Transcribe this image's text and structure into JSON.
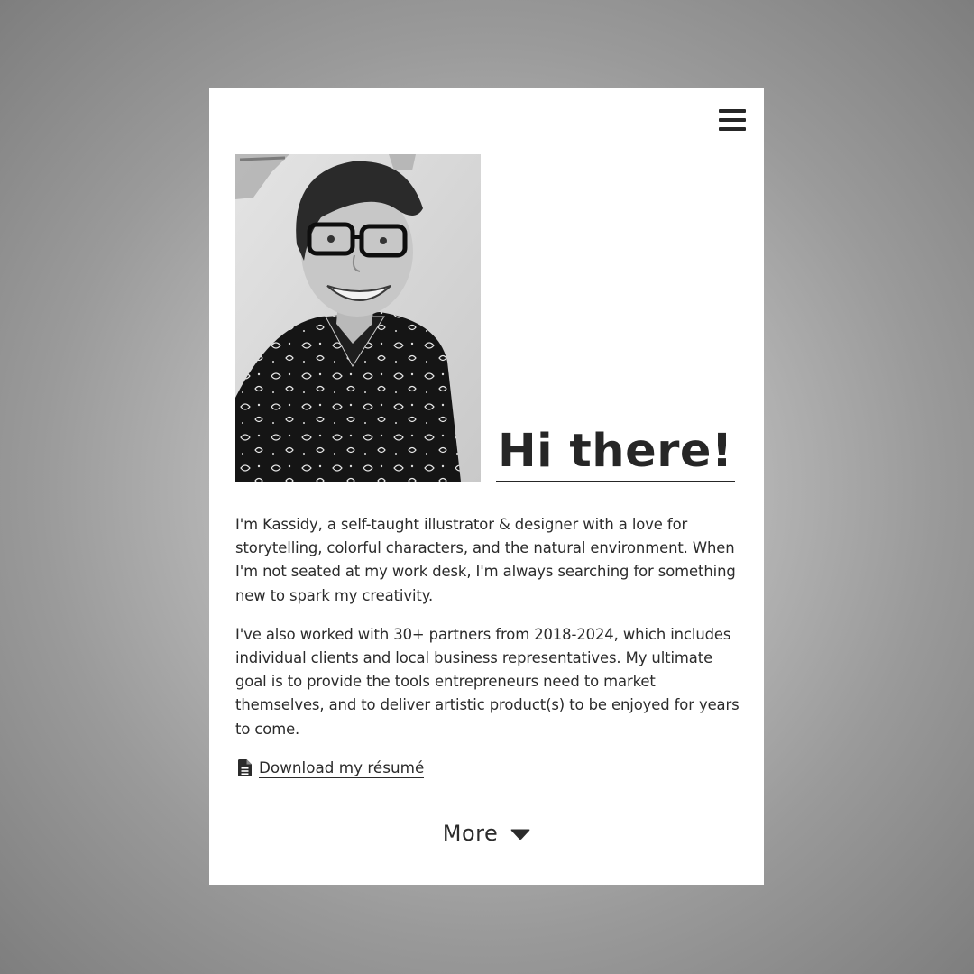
{
  "header": {
    "menu_icon": "hamburger-menu-icon"
  },
  "hero": {
    "title": "Hi there!",
    "photo_alt": "portrait-photo"
  },
  "bio": {
    "paragraphs": [
      "I'm Kassidy, a self-taught illustrator & designer with a love for storytelling, colorful characters, and the natural environment. When I'm not seated at my work desk, I'm always searching for something new to spark my creativity.",
      "I've also worked with 30+ partners from 2018-2024, which includes individual clients and local business representatives. My ultimate goal is to provide the tools entrepreneurs need to market themselves, and to deliver artistic product(s) to be enjoyed for years to come."
    ]
  },
  "resume": {
    "label": "Download my résumé",
    "icon": "file-document-icon"
  },
  "more": {
    "label": "More",
    "icon": "caret-down-icon"
  },
  "colors": {
    "text": "#2b2b2b",
    "card": "#ffffff"
  }
}
